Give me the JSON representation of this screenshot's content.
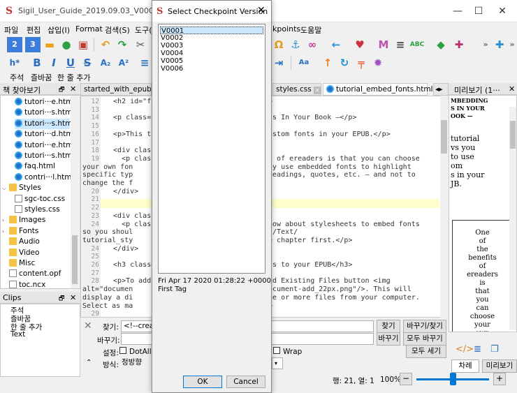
{
  "window": {
    "title": "Sigil_User_Guide_2019.09.03_V0002.epub* - ep",
    "minimize": "—",
    "maximize": "☐",
    "close": "✕"
  },
  "menu": {
    "items": [
      "파일",
      "편집",
      "삽입(I)",
      "Format",
      "검색(S)",
      "도구(",
      "kpoints",
      "도움말"
    ]
  },
  "format_bar": {
    "labels": [
      "주석",
      "즐바꿈",
      "한 줄 추가"
    ]
  },
  "book_browser": {
    "title": "책 찾아보기",
    "items": [
      {
        "label": "tutori···e.html",
        "type": "html",
        "indent": 20
      },
      {
        "label": "tutori···s.html",
        "type": "html",
        "indent": 20
      },
      {
        "label": "tutori···s.html",
        "type": "html",
        "indent": 20
      },
      {
        "label": "tutori···d.html",
        "type": "html",
        "indent": 20
      },
      {
        "label": "tutori···e.html",
        "type": "html",
        "indent": 20
      },
      {
        "label": "tutori···s.html",
        "type": "html",
        "indent": 20
      },
      {
        "label": "faq.html",
        "type": "html",
        "indent": 20
      },
      {
        "label": "contri···l.html",
        "type": "html",
        "indent": 20
      },
      {
        "label": "Styles",
        "type": "folder",
        "indent": 12,
        "expanded": true
      },
      {
        "label": "sgc-toc.css",
        "type": "file",
        "indent": 20
      },
      {
        "label": "styles.css",
        "type": "file",
        "indent": 20
      },
      {
        "label": "Images",
        "type": "folder",
        "indent": 12,
        "expanded": false
      },
      {
        "label": "Fonts",
        "type": "folder",
        "indent": 12,
        "expanded": false
      },
      {
        "label": "Audio",
        "type": "folder",
        "indent": 12
      },
      {
        "label": "Video",
        "type": "folder",
        "indent": 12
      },
      {
        "label": "Misc",
        "type": "folder",
        "indent": 12
      },
      {
        "label": "content.opf",
        "type": "file",
        "indent": 12
      },
      {
        "label": "toc.ncx",
        "type": "file",
        "indent": 12
      }
    ]
  },
  "clips": {
    "title": "Clips",
    "items": [
      "주석",
      "즐바꿈",
      "한 줄 추가",
      "Text"
    ]
  },
  "tabs": [
    {
      "label": "started_with_epub.html",
      "active": false
    },
    {
      "label": "styles.css",
      "active": false
    },
    {
      "label": "tutorial_embed_fonts.html",
      "active": true
    }
  ],
  "editor": {
    "lines": [
      {
        "n": "12",
        "text": "  <h2 id=\"fo"
      },
      {
        "n": "13",
        "text": ""
      },
      {
        "n": "14",
        "text": "  <p class=\""
      },
      {
        "n": "15",
        "text": ""
      },
      {
        "n": "16",
        "text": "  <p>This tu"
      },
      {
        "n": "17",
        "text": ""
      },
      {
        "n": "18",
        "text": "  <div class"
      },
      {
        "n": "19",
        "text": "    <p class"
      },
      {
        "n": "",
        "text": "your own fon"
      },
      {
        "n": "",
        "text": "specific typ"
      },
      {
        "n": "",
        "text": "change the f"
      },
      {
        "n": "20",
        "text": "  </div>"
      },
      {
        "n": "21",
        "text": ""
      },
      {
        "n": "22",
        "text": ""
      },
      {
        "n": "23",
        "text": "  <div class"
      },
      {
        "n": "24",
        "text": "    <p class"
      },
      {
        "n": "",
        "text": "so you shoul"
      },
      {
        "n": "",
        "text": "tutorial_sty"
      },
      {
        "n": "24",
        "text": "  </div>"
      },
      {
        "n": "25",
        "text": ""
      },
      {
        "n": "26",
        "text": "  <h3 class="
      },
      {
        "n": "27",
        "text": ""
      },
      {
        "n": "28",
        "text": "  <p>To add"
      },
      {
        "n": "",
        "text": "alt=\"documen"
      },
      {
        "n": "",
        "text": "display a di"
      },
      {
        "n": "",
        "text": "Select as ma"
      },
      {
        "n": "29",
        "text": ""
      }
    ],
    "right_fragments": [
      {
        "row": 0,
        "text": "2>"
      },
      {
        "row": 2,
        "text": "nts In Your Book —</p>"
      },
      {
        "row": 4,
        "text": "custom fonts in your EPUB.</p>"
      },
      {
        "row": 7,
        "text": "ts of ereaders is that you can choose"
      },
      {
        "row": 8,
        "text": "nly use embedded fonts to highlight"
      },
      {
        "row": 9,
        "text": " headings, quotes, etc. – and not to"
      },
      {
        "row": 15,
        "text": "know about stylesheets to embed fonts"
      },
      {
        "row": 16,
        "text": "../Text/"
      },
      {
        "row": 17,
        "text": "a> chapter first.</p>"
      },
      {
        "row": 20,
        "text": "nts to your EPUB</h3>"
      },
      {
        "row": 22,
        "text": "Add Existing Files button <img"
      },
      {
        "row": 23,
        "text": "document-add_22px.png\"/>. This will"
      },
      {
        "row": 24,
        "text": "one or more files from your computer."
      },
      {
        "row": 25,
        "text": "p>"
      }
    ]
  },
  "find": {
    "find_label": "찾기:",
    "find_value": "<!--creat",
    "replace_label": "바꾸기:",
    "replace_value": "",
    "settings_label": "설정:",
    "dotall_label": "DotAll",
    "wrap_label": "Wrap",
    "mode_label": "방식:",
    "mode_value": "정방향",
    "find_button": "찾기",
    "replace_find_button": "바꾸기/찾기",
    "replace_button": "바꾸기",
    "replace_all_button": "모두 바꾸기",
    "count_all_button": "모두 세기"
  },
  "preview": {
    "title": "미리보기 (1···",
    "heading_lines": [
      "MBEDDING",
      "S IN YOUR",
      "OOK —"
    ],
    "para_lines": [
      "tutorial",
      "vs you",
      "to use",
      "om",
      "s in your",
      "JB."
    ],
    "box_lines": [
      "One",
      "of",
      "the",
      "benefits",
      "of",
      "ereaders",
      "is",
      "that",
      "you",
      "can",
      "choose",
      "your",
      "own"
    ],
    "tab_labels": [
      "차례",
      "미리보기"
    ]
  },
  "status": {
    "position": "행: 21, 열: 1",
    "zoom": "100%"
  },
  "dialog": {
    "title": "Select Checkpoint Version",
    "versions": [
      "V0001",
      "V0002",
      "V0003",
      "V0004",
      "V0005",
      "V0006"
    ],
    "selected_index": 0,
    "info_date": "Fri Apr 17 2020 01:28:22 +0000",
    "info_tag": "First Tag",
    "ok_button": "OK",
    "cancel_button": "Cancel"
  },
  "colors": {
    "accent": "#0078d7",
    "selected_item": "#cce8ff",
    "highlight_line": "#ffffcc",
    "brand_red": "#c0392b"
  }
}
